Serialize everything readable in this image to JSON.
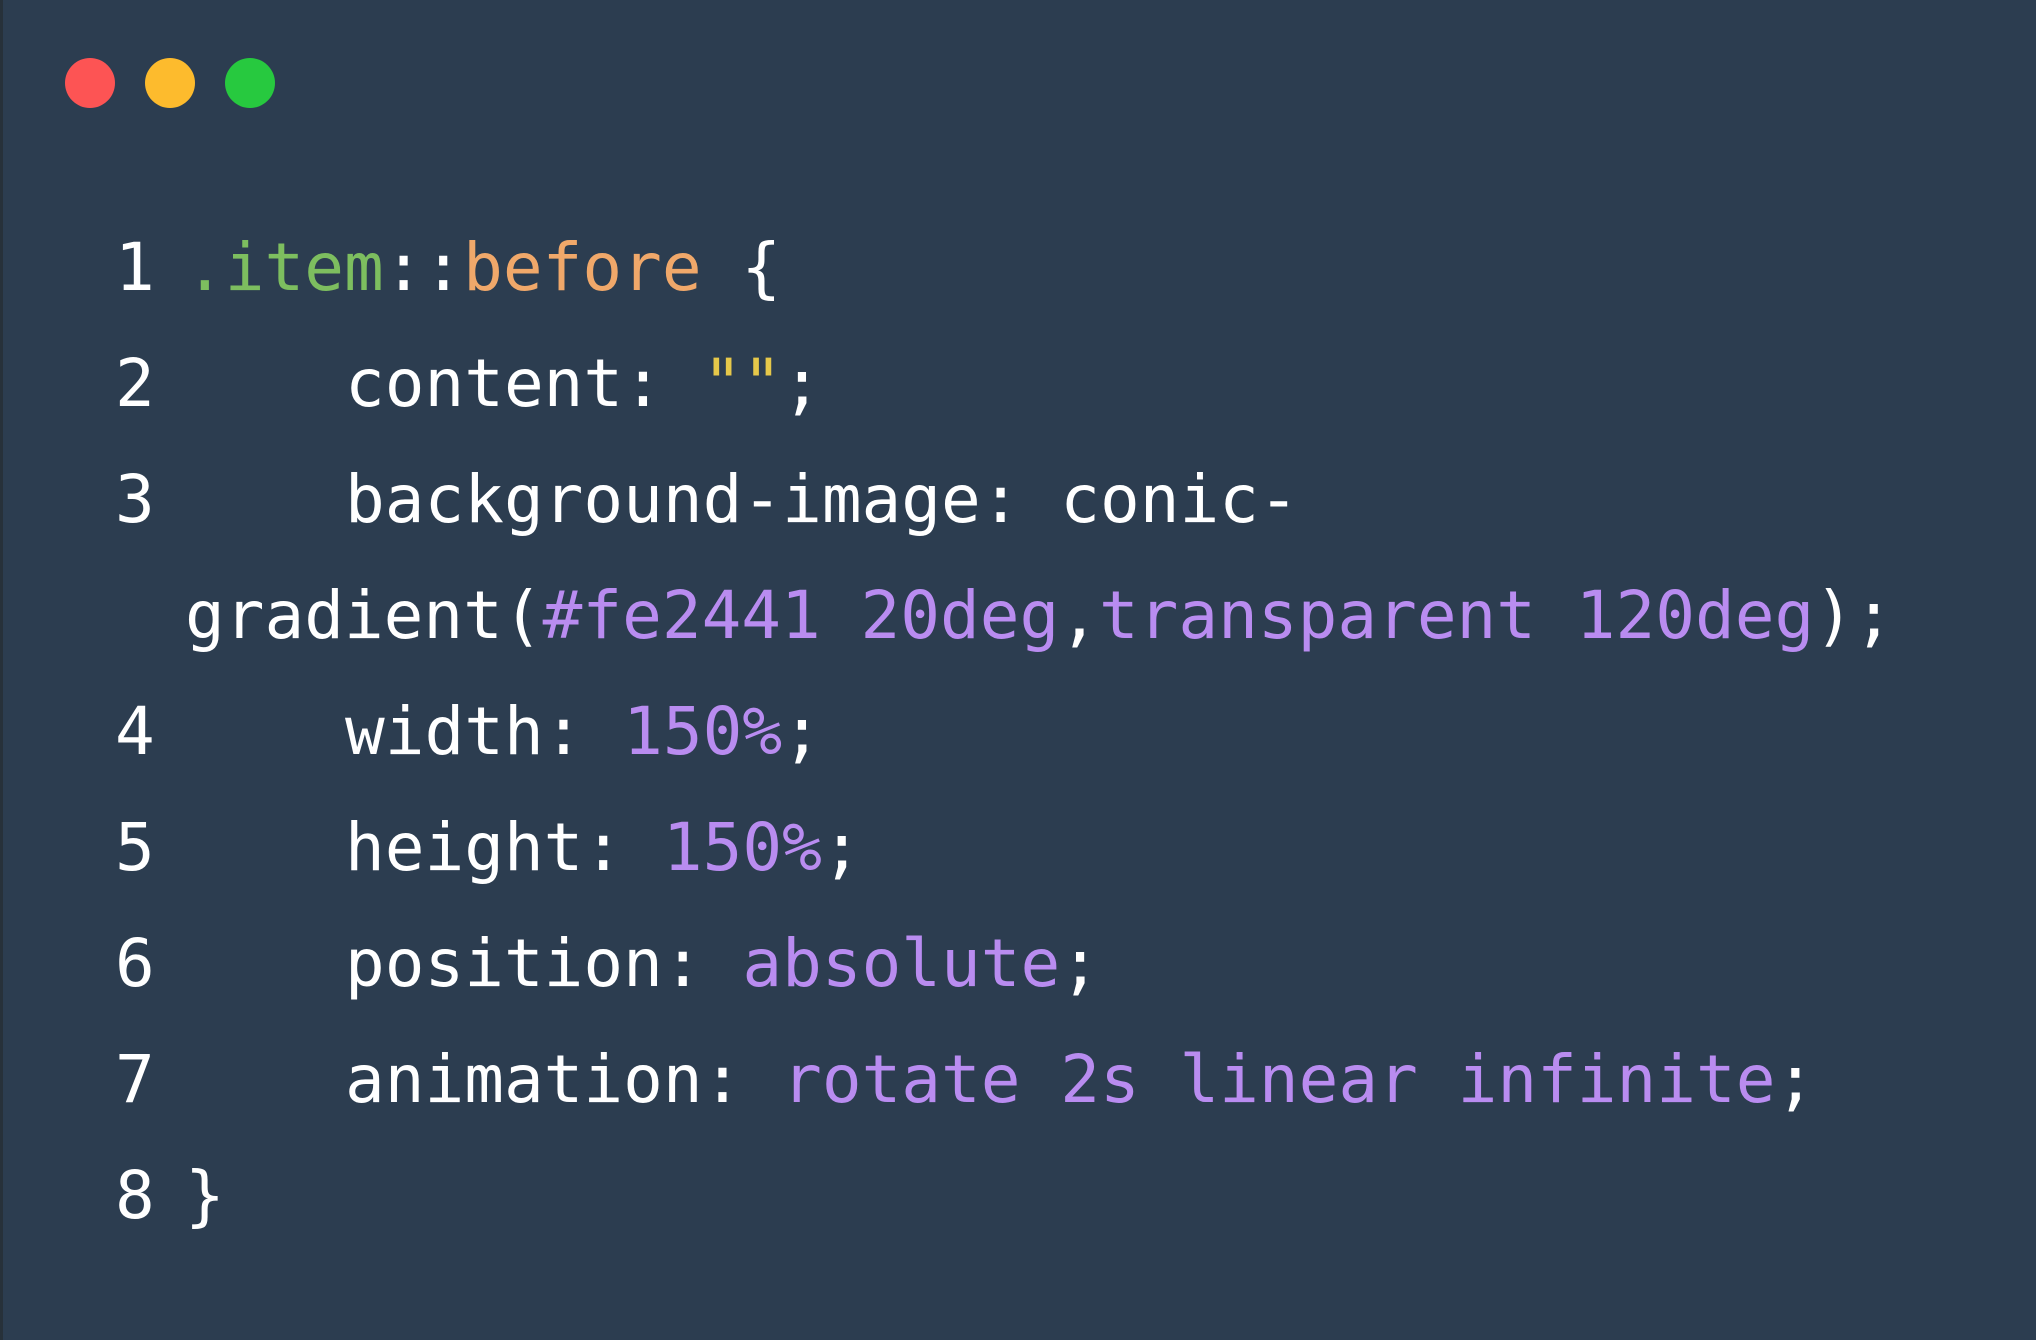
{
  "colors": {
    "background": "#2c3d50",
    "text": "#ffffff",
    "selector": "#7dbe5f",
    "pseudo": "#f0a86a",
    "string": "#e6c84a",
    "value": "#b98cf0",
    "close": "#fd5454",
    "minimize": "#fdbb2d",
    "maximize": "#27c93f"
  },
  "window_controls": [
    {
      "name": "close",
      "icon": "close-dot-icon"
    },
    {
      "name": "minimize",
      "icon": "minimize-dot-icon"
    },
    {
      "name": "maximize",
      "icon": "maximize-dot-icon"
    }
  ],
  "code": {
    "lines": [
      {
        "number": "1",
        "tokens": [
          ".item",
          "::",
          "before",
          " {"
        ]
      },
      {
        "number": "2",
        "tokens": [
          "content: ",
          "\"\"",
          ";"
        ]
      },
      {
        "number": "3",
        "tokens": [
          "background-image: conic-"
        ]
      },
      {
        "number": "",
        "tokens": [
          "gradient(",
          "#fe2441 20deg",
          ",",
          "transparent 120deg",
          ");"
        ]
      },
      {
        "number": "4",
        "tokens": [
          "width: ",
          "150%",
          ";"
        ]
      },
      {
        "number": "5",
        "tokens": [
          "height: ",
          "150%",
          ";"
        ]
      },
      {
        "number": "6",
        "tokens": [
          "position: ",
          "absolute",
          ";"
        ]
      },
      {
        "number": "7",
        "tokens": [
          "animation: ",
          "rotate 2s linear infinite",
          ";"
        ]
      },
      {
        "number": "8",
        "tokens": [
          "}"
        ]
      }
    ]
  }
}
